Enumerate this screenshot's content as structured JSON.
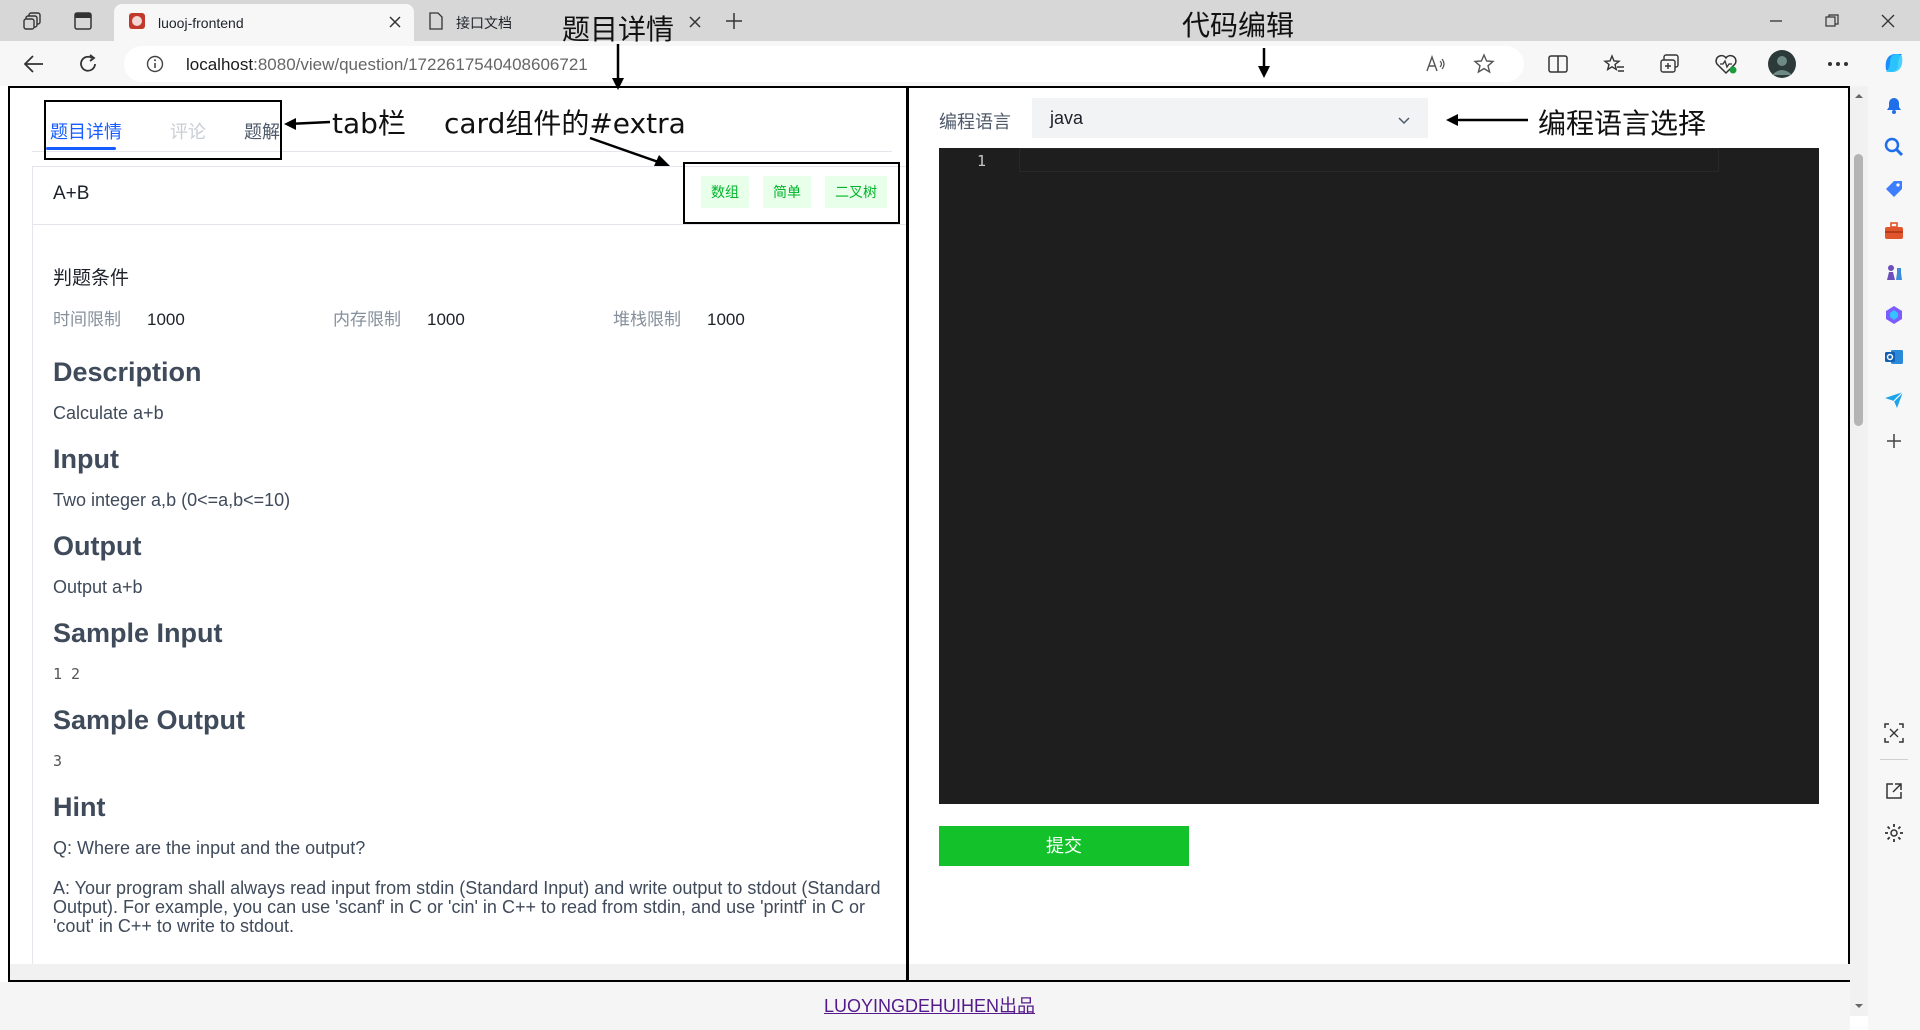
{
  "browser": {
    "tabs": [
      {
        "title": "luooj-frontend",
        "active": true
      },
      {
        "title": "接口文档",
        "active": false
      }
    ],
    "url_host": "localhost",
    "url_rest": ":8080/view/question/1722617540408606721"
  },
  "page": {
    "tabs": [
      "题目详情",
      "评论",
      "题解"
    ],
    "question": {
      "title": "A+B",
      "tags": [
        "数组",
        "简单",
        "二叉树"
      ],
      "judge_title": "判题条件",
      "judge": [
        {
          "label": "时间限制",
          "value": "1000"
        },
        {
          "label": "内存限制",
          "value": "1000"
        },
        {
          "label": "堆栈限制",
          "value": "1000"
        }
      ],
      "sections": {
        "description_h": "Description",
        "description": "Calculate a+b",
        "input_h": "Input",
        "input": "Two integer a,b (0<=a,b<=10)",
        "output_h": "Output",
        "output": "Output a+b",
        "sample_input_h": "Sample Input",
        "sample_input": "1 2",
        "sample_output_h": "Sample Output",
        "sample_output": "3",
        "hint_h": "Hint",
        "hint_q": "Q: Where are the input and the output?",
        "hint_a": "A: Your program shall always read input from stdin (Standard Input) and write output to stdout (Standard Output). For example, you can use 'scanf' in C or 'cin' in C++ to read from stdin, and use 'printf' in C or 'cout' in C++ to write to stdout."
      }
    },
    "editor": {
      "lang_label": "编程语言",
      "lang_value": "java",
      "line_number": "1",
      "submit_label": "提交"
    },
    "footer_link": "LUOYINGDEHUIHEN出品"
  },
  "annotations": {
    "question_detail": "题目详情",
    "code_editor": "代码编辑",
    "tab_bar": "tab栏",
    "card_extra": "card组件的#extra",
    "lang_select": "编程语言选择"
  },
  "colors": {
    "primary": "#165dff",
    "tag_green": "#00b42a",
    "submit_green": "#13c22a",
    "editor_bg": "#1e1e1e"
  }
}
